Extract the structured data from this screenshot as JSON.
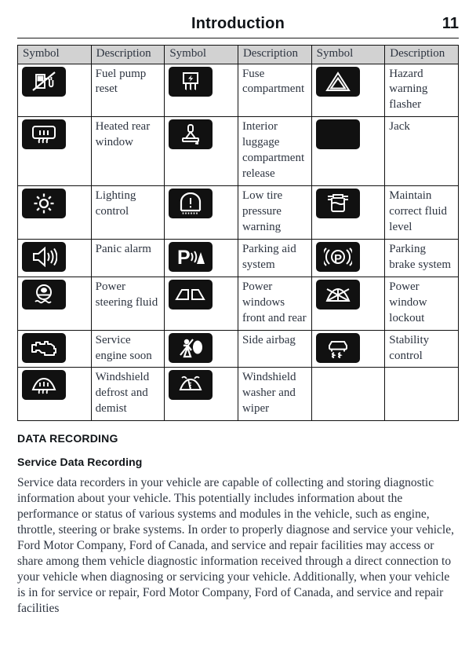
{
  "header": {
    "title": "Introduction",
    "page_number": "11"
  },
  "table": {
    "columns": [
      "Symbol",
      "Description",
      "Symbol",
      "Description",
      "Symbol",
      "Description"
    ],
    "rows": [
      [
        {
          "icon": "fuel-pump-reset-icon",
          "label": "Fuel pump reset"
        },
        {
          "icon": "fuse-compartment-icon",
          "label": "Fuse compartment"
        },
        {
          "icon": "hazard-warning-flasher-icon",
          "label": "Hazard warning flasher"
        }
      ],
      [
        {
          "icon": "heated-rear-window-icon",
          "label": "Heated rear window"
        },
        {
          "icon": "interior-luggage-compartment-release-icon",
          "label": "Interior luggage compartment release"
        },
        {
          "icon": "jack-icon",
          "label": "Jack"
        }
      ],
      [
        {
          "icon": "lighting-control-icon",
          "label": "Lighting control"
        },
        {
          "icon": "low-tire-pressure-warning-icon",
          "label": "Low tire pressure warning"
        },
        {
          "icon": "maintain-correct-fluid-level-icon",
          "label": "Maintain correct fluid level"
        }
      ],
      [
        {
          "icon": "panic-alarm-icon",
          "label": "Panic alarm"
        },
        {
          "icon": "parking-aid-system-icon",
          "label": "Parking aid system"
        },
        {
          "icon": "parking-brake-system-icon",
          "label": "Parking brake system"
        }
      ],
      [
        {
          "icon": "power-steering-fluid-icon",
          "label": "Power steering fluid"
        },
        {
          "icon": "power-windows-front-and-rear-icon",
          "label": "Power windows front and rear"
        },
        {
          "icon": "power-window-lockout-icon",
          "label": "Power window lockout"
        }
      ],
      [
        {
          "icon": "service-engine-soon-icon",
          "label": "Service engine soon"
        },
        {
          "icon": "side-airbag-icon",
          "label": "Side airbag"
        },
        {
          "icon": "stability-control-icon",
          "label": "Stability control"
        }
      ],
      [
        {
          "icon": "windshield-defrost-and-demist-icon",
          "label": "Windshield defrost and demist"
        },
        {
          "icon": "windshield-washer-and-wiper-icon",
          "label": "Windshield washer and wiper"
        },
        {
          "icon": "",
          "label": ""
        }
      ]
    ]
  },
  "content": {
    "section_heading": "DATA RECORDING",
    "subsection_heading": "Service Data Recording",
    "paragraph": "Service data recorders in your vehicle are capable of collecting and storing diagnostic information about your vehicle. This potentially includes information about the performance or status of various systems and modules in the vehicle, such as engine, throttle, steering or brake systems. In order to properly diagnose and service your vehicle, Ford Motor Company, Ford of Canada, and service and repair facilities may access or share among them vehicle diagnostic information received through a direct connection to your vehicle when diagnosing or servicing your vehicle. Additionally, when your vehicle is in for service or repair, Ford Motor Company, Ford of Canada, and service and repair facilities"
  },
  "colors": {
    "ink": "#2d3440",
    "rule": "#111111",
    "header_fill": "#d2d2d2",
    "tile_fill": "#111111",
    "glyph": "#ffffff"
  }
}
